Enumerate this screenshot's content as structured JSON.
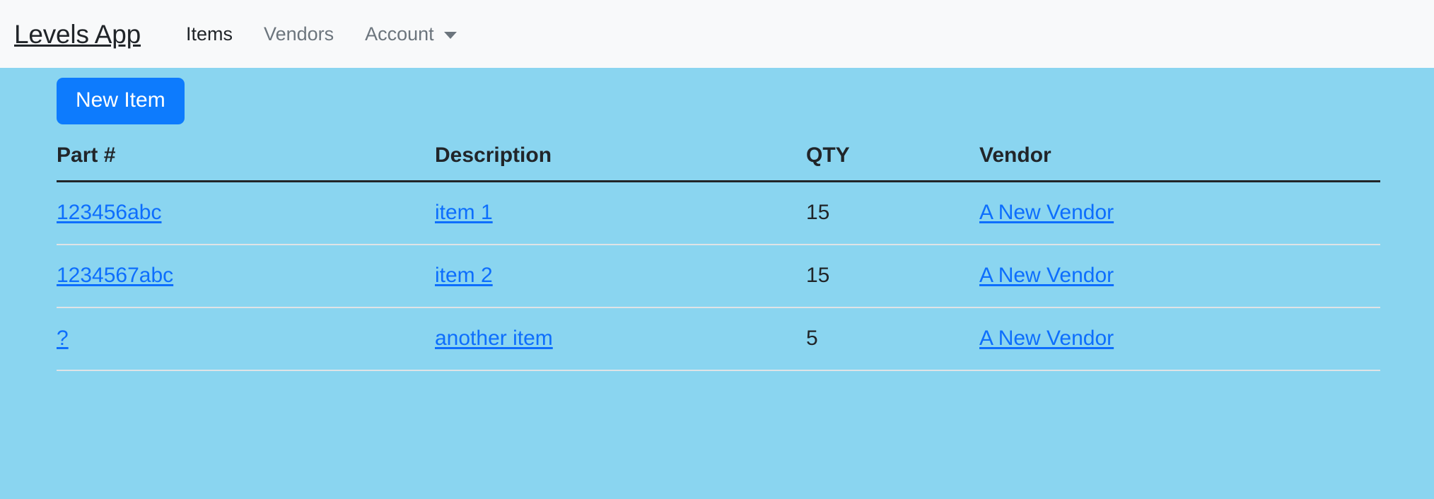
{
  "navbar": {
    "brand": "Levels App",
    "links": [
      {
        "label": "Items",
        "active": true
      },
      {
        "label": "Vendors",
        "active": false
      }
    ],
    "dropdown": {
      "label": "Account",
      "caret_icon": "chevron-down-icon"
    }
  },
  "main": {
    "new_item_button": "New Item",
    "table": {
      "headers": {
        "part": "Part #",
        "description": "Description",
        "qty": "QTY",
        "vendor": "Vendor"
      },
      "rows": [
        {
          "part": "123456abc",
          "description": "item 1",
          "qty": "15",
          "vendor": "A New Vendor"
        },
        {
          "part": "1234567abc",
          "description": "item 2",
          "qty": "15",
          "vendor": "A New Vendor"
        },
        {
          "part": "?",
          "description": "another item",
          "qty": "5",
          "vendor": "A New Vendor"
        }
      ]
    }
  },
  "colors": {
    "navbar_bg": "#f8f9fa",
    "body_bg": "#8ad5f0",
    "button_bg": "#0d7bfd",
    "link": "#0d6efd",
    "text": "#212529",
    "muted_text": "#6c757d",
    "header_border": "#212529",
    "row_border": "#dfe3e6"
  }
}
